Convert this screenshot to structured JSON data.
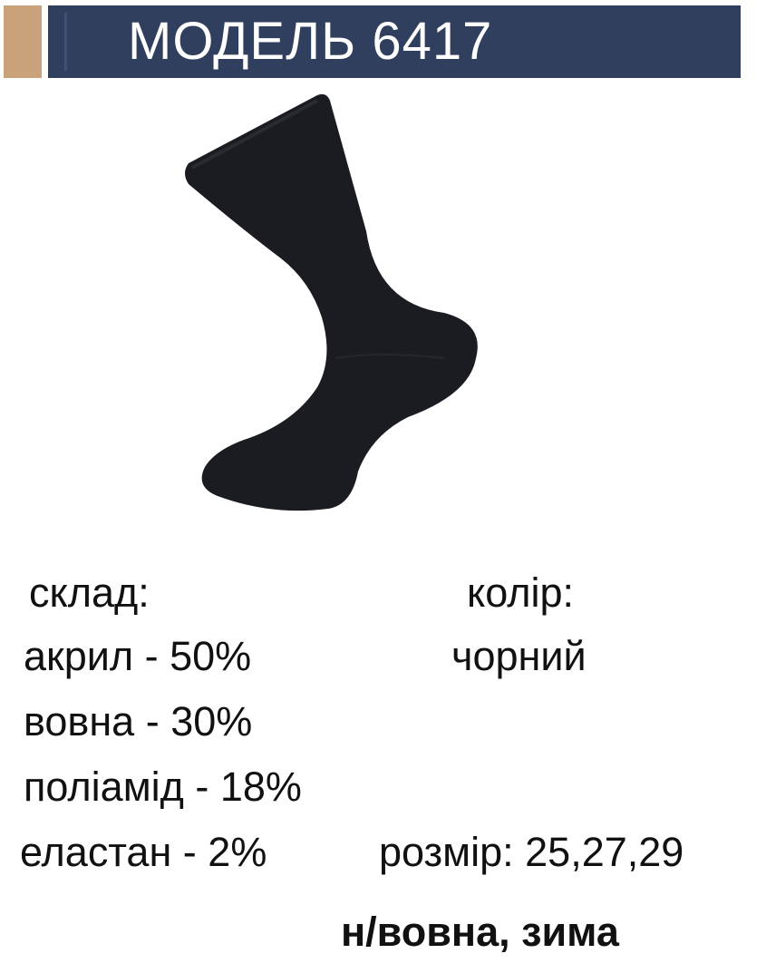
{
  "header": {
    "title": "МОДЕЛЬ 6417",
    "bar_color": "#2f3f5d",
    "accent_color": "#c9a27b"
  },
  "product_image": {
    "icon": "black-sock-image"
  },
  "composition": {
    "label": "склад:",
    "items": [
      "акрил - 50%",
      "вовна - 30%",
      "поліамід - 18%",
      "еластан - 2%"
    ]
  },
  "color": {
    "label": "колір:",
    "value": "чорний"
  },
  "size": {
    "text": "розмір: 25,27,29"
  },
  "season": {
    "text": "н/вовна, зима"
  }
}
